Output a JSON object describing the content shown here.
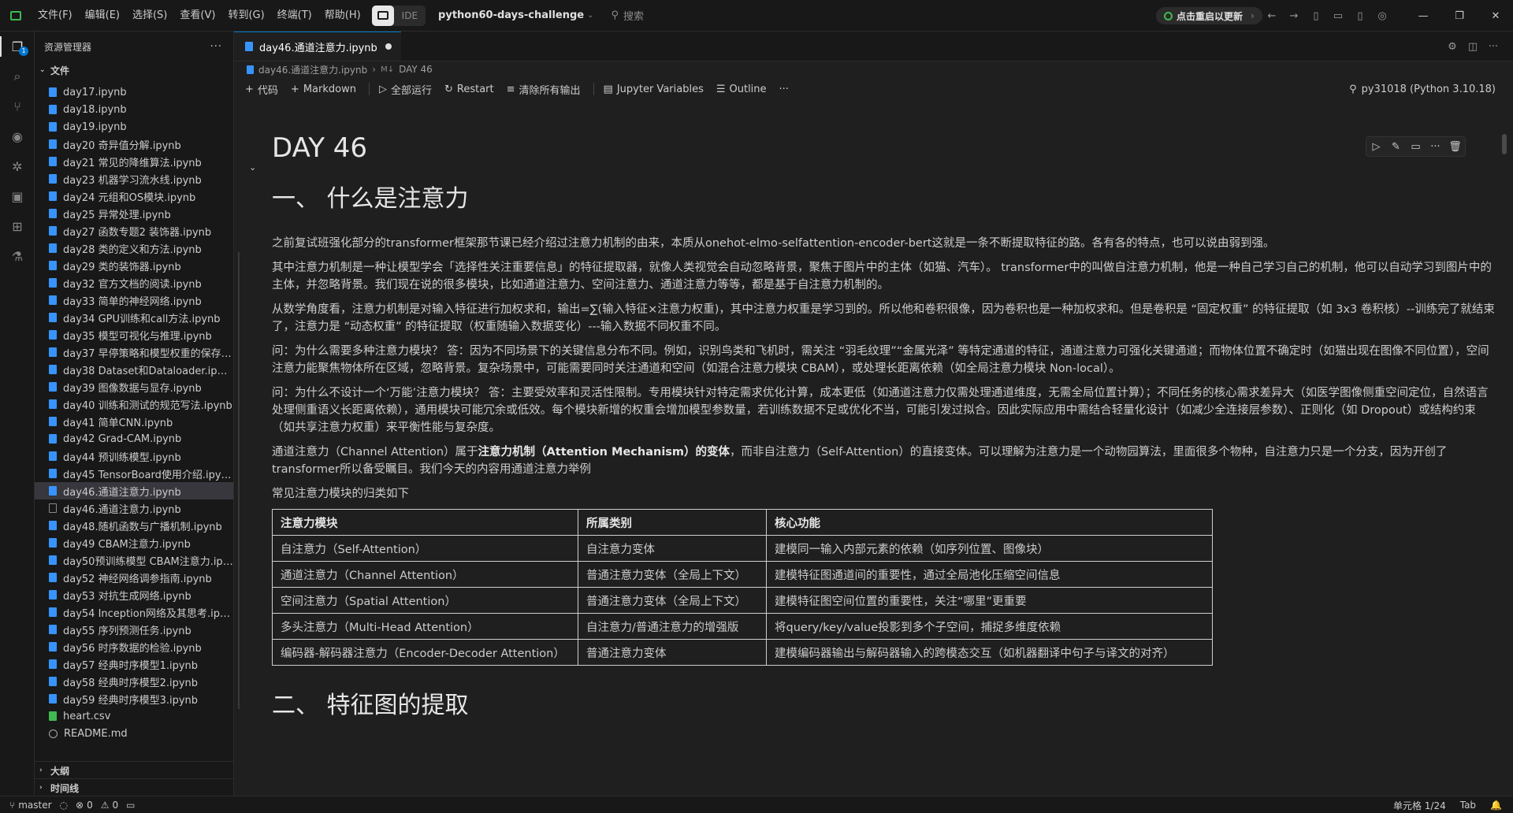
{
  "titlebar": {
    "menus": [
      "文件(F)",
      "编辑(E)",
      "选择(S)",
      "查看(V)",
      "转到(G)",
      "终端(T)",
      "帮助(H)"
    ],
    "ide_label": "IDE",
    "project": "python60-days-challenge",
    "search_placeholder": "搜索",
    "restart_label": "点击重启以更新"
  },
  "sidebar": {
    "title": "资源管理器",
    "files_section": "文件",
    "outline_section": "大纲",
    "timeline_section": "时间线",
    "files": [
      {
        "name": "day17.ipynb",
        "type": "nb"
      },
      {
        "name": "day18.ipynb",
        "type": "nb"
      },
      {
        "name": "day19.ipynb",
        "type": "nb"
      },
      {
        "name": "day20 奇异值分解.ipynb",
        "type": "nb"
      },
      {
        "name": "day21 常见的降维算法.ipynb",
        "type": "nb"
      },
      {
        "name": "day23 机器学习流水线.ipynb",
        "type": "nb"
      },
      {
        "name": "day24 元组和OS模块.ipynb",
        "type": "nb"
      },
      {
        "name": "day25 异常处理.ipynb",
        "type": "nb"
      },
      {
        "name": "day27 函数专题2 装饰器.ipynb",
        "type": "nb"
      },
      {
        "name": "day28 类的定义和方法.ipynb",
        "type": "nb"
      },
      {
        "name": "day29 类的装饰器.ipynb",
        "type": "nb"
      },
      {
        "name": "day32 官方文档的阅读.ipynb",
        "type": "nb"
      },
      {
        "name": "day33 简单的神经网络.ipynb",
        "type": "nb"
      },
      {
        "name": "day34 GPU训练和call方法.ipynb",
        "type": "nb"
      },
      {
        "name": "day35 模型可视化与推理.ipynb",
        "type": "nb"
      },
      {
        "name": "day37 早停策略和模型权重的保存.ipynb",
        "type": "nb"
      },
      {
        "name": "day38 Dataset和Dataloader.ipynb",
        "type": "nb"
      },
      {
        "name": "day39 图像数据与显存.ipynb",
        "type": "nb"
      },
      {
        "name": "day40 训练和测试的规范写法.ipynb",
        "type": "nb"
      },
      {
        "name": "day41 简单CNN.ipynb",
        "type": "nb"
      },
      {
        "name": "day42 Grad-CAM.ipynb",
        "type": "nb"
      },
      {
        "name": "day44 预训练模型.ipynb",
        "type": "nb"
      },
      {
        "name": "day45 TensorBoard使用介绍.ipynb",
        "type": "nb"
      },
      {
        "name": "day46.通道注意力.ipynb",
        "type": "nb",
        "active": true
      },
      {
        "name": "day46.通道注意力.ipynb",
        "type": "outline"
      },
      {
        "name": "day48.随机函数与广播机制.ipynb",
        "type": "nb"
      },
      {
        "name": "day49 CBAM注意力.ipynb",
        "type": "nb"
      },
      {
        "name": "day50预训练模型 CBAM注意力.ipynb",
        "type": "nb"
      },
      {
        "name": "day52 神经网络调参指南.ipynb",
        "type": "nb"
      },
      {
        "name": "day53 对抗生成网络.ipynb",
        "type": "nb"
      },
      {
        "name": "day54 Inception网络及其思考.ipynb",
        "type": "nb"
      },
      {
        "name": "day55 序列预测任务.ipynb",
        "type": "nb"
      },
      {
        "name": "day56 时序数据的检验.ipynb",
        "type": "nb"
      },
      {
        "name": "day57 经典时序模型1.ipynb",
        "type": "nb"
      },
      {
        "name": "day58 经典时序模型2.ipynb",
        "type": "nb"
      },
      {
        "name": "day59 经典时序模型3.ipynb",
        "type": "nb"
      },
      {
        "name": "heart.csv",
        "type": "csv"
      },
      {
        "name": "README.md",
        "type": "info"
      }
    ]
  },
  "editor": {
    "tab_label": "day46.通道注意力.ipynb",
    "breadcrumb_file": "day46.通道注意力.ipynb",
    "breadcrumb_section": "DAY 46",
    "toolbar": {
      "code": "代码",
      "markdown": "Markdown",
      "run_all": "全部运行",
      "restart": "Restart",
      "clear": "清除所有输出",
      "variables": "Jupyter Variables",
      "outline": "Outline",
      "kernel": "py31018 (Python 3.10.18)"
    }
  },
  "notebook": {
    "h1": "DAY 46",
    "h2_1": "一、 什么是注意力",
    "p1": "之前复试班强化部分的transformer框架那节课已经介绍过注意力机制的由来，本质从onehot-elmo-selfattention-encoder-bert这就是一条不断提取特征的路。各有各的特点，也可以说由弱到强。",
    "p2": "其中注意力机制是一种让模型学会「选择性关注重要信息」的特征提取器，就像人类视觉会自动忽略背景，聚焦于图片中的主体（如猫、汽车）。 transformer中的叫做自注意力机制，他是一种自己学习自己的机制，他可以自动学习到图片中的主体，并忽略背景。我们现在说的很多模块，比如通道注意力、空间注意力、通道注意力等等，都是基于自注意力机制的。",
    "p3": "从数学角度看，注意力机制是对输入特征进行加权求和，输出=∑(输入特征×注意力权重)，其中注意力权重是学习到的。所以他和卷积很像，因为卷积也是一种加权求和。但是卷积是 “固定权重” 的特征提取（如 3x3 卷积核）--训练完了就结束了，注意力是 “动态权重” 的特征提取（权重随输入数据变化）---输入数据不同权重不同。",
    "p4": "问：为什么需要多种注意力模块？ 答：因为不同场景下的关键信息分布不同。例如，识别鸟类和飞机时，需关注 “羽毛纹理”“金属光泽” 等特定通道的特征，通道注意力可强化关键通道；而物体位置不确定时（如猫出现在图像不同位置），空间注意力能聚焦物体所在区域，忽略背景。复杂场景中，可能需要同时关注通道和空间（如混合注意力模块 CBAM），或处理长距离依赖（如全局注意力模块 Non-local）。",
    "p5": "问：为什么不设计一个‘万能’注意力模块？ 答：主要受效率和灵活性限制。专用模块针对特定需求优化计算，成本更低（如通道注意力仅需处理通道维度，无需全局位置计算）；不同任务的核心需求差异大（如医学图像侧重空间定位，自然语言处理侧重语义长距离依赖），通用模块可能冗余或低效。每个模块新增的权重会增加模型参数量，若训练数据不足或优化不当，可能引发过拟合。因此实际应用中需结合轻量化设计（如减少全连接层参数）、正则化（如 Dropout）或结构约束（如共享注意力权重）来平衡性能与复杂度。",
    "p6_a": "通道注意力（Channel Attention）属于",
    "p6_b": "注意力机制（Attention Mechanism）的变体",
    "p6_c": "，而非自注意力（Self-Attention）的直接变体。可以理解为注意力是一个动物园算法，里面很多个物种，自注意力只是一个分支，因为开创了transformer所以备受瞩目。我们今天的内容用通道注意力举例",
    "p7": "常见注意力模块的归类如下",
    "table": {
      "headers": [
        "注意力模块",
        "所属类别",
        "核心功能"
      ],
      "rows": [
        [
          "自注意力（Self-Attention）",
          "自注意力变体",
          "建模同一输入内部元素的依赖（如序列位置、图像块）"
        ],
        [
          "通道注意力（Channel Attention）",
          "普通注意力变体（全局上下文）",
          "建模特征图通道间的重要性，通过全局池化压缩空间信息"
        ],
        [
          "空间注意力（Spatial Attention）",
          "普通注意力变体（全局上下文）",
          "建模特征图空间位置的重要性，关注“哪里”更重要"
        ],
        [
          "多头注意力（Multi-Head Attention）",
          "自注意力/普通注意力的增强版",
          "将query/key/value投影到多个子空间，捕捉多维度依赖"
        ],
        [
          "编码器-解码器注意力（Encoder-Decoder Attention）",
          "普通注意力变体",
          "建模编码器输出与解码器输入的跨模态交互（如机器翻译中句子与译文的对齐）"
        ]
      ]
    },
    "h2_2": "二、 特征图的提取"
  },
  "statusbar": {
    "branch": "master",
    "errors": "0",
    "warnings": "0",
    "cell": "单元格 1/24",
    "indent": "Tab"
  }
}
